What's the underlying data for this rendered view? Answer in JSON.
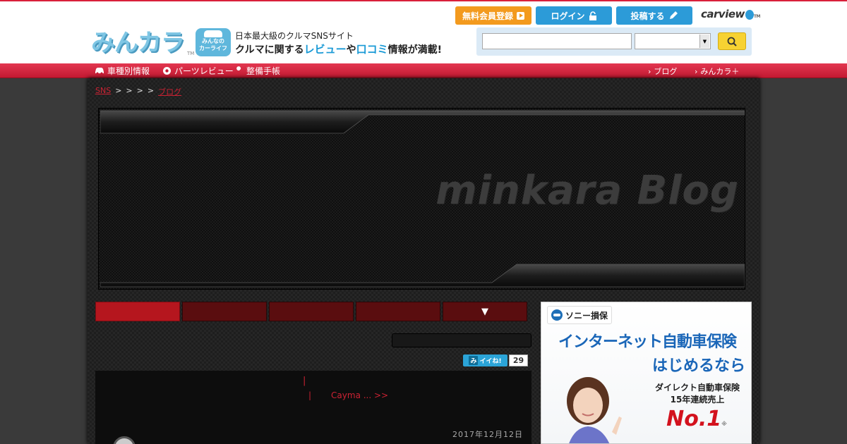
{
  "header": {
    "logo_text": "みんカラ",
    "logo_tm": "TM",
    "badge_top": "みんなの",
    "badge_bottom": "カーライフ",
    "tagline1": "日本最大級のクルマSNSサイト",
    "tagline2_pre": "クルマに関する",
    "tagline2_review": "レビュー",
    "tagline2_mid": "や",
    "tagline2_kuchikomi": "口コミ",
    "tagline2_post": "情報が満載!",
    "register_label": "無料会員登録",
    "login_label": "ログイン",
    "post_label": "投稿する",
    "carview_label": "carview",
    "carview_tm": "TM",
    "search_value": "",
    "select_value": ""
  },
  "nav": {
    "left": [
      {
        "label": "車種別情報",
        "icon": "car-icon"
      },
      {
        "label": "パーツレビュー",
        "icon": "gear-icon"
      },
      {
        "label": "整備手帳",
        "icon": "wrench-icon"
      }
    ],
    "right": [
      {
        "label": "ブログ"
      },
      {
        "label": "みんカラ＋"
      }
    ]
  },
  "breadcrumb": {
    "first": "SNS",
    "sep": ">",
    "last": "ブログ"
  },
  "banner": {
    "title": "minkara Blog"
  },
  "tabs": {
    "more_label": "▼"
  },
  "entry": {
    "like_label": "イイね!",
    "like_count": "29",
    "separator": "|",
    "nav_prev": "|",
    "nav_next": "Cayma ... >>",
    "date": "2017年12月12日"
  },
  "ad": {
    "brand": "ソニー損保",
    "line1": "インターネット自動車保険",
    "line2": "はじめるなら",
    "sub1": "ダイレクト自動車保険",
    "sub2": "15年連続売上",
    "no1": "No.1",
    "note": "※"
  },
  "colors": {
    "brand_red": "#d9203a",
    "accent_blue": "#2c9bd8",
    "register_orange": "#f39a1e",
    "search_yellow": "#f7d232",
    "tab_active": "#b5161e",
    "tab_inactive": "#5a0d0f",
    "link_red": "#cc2233"
  }
}
